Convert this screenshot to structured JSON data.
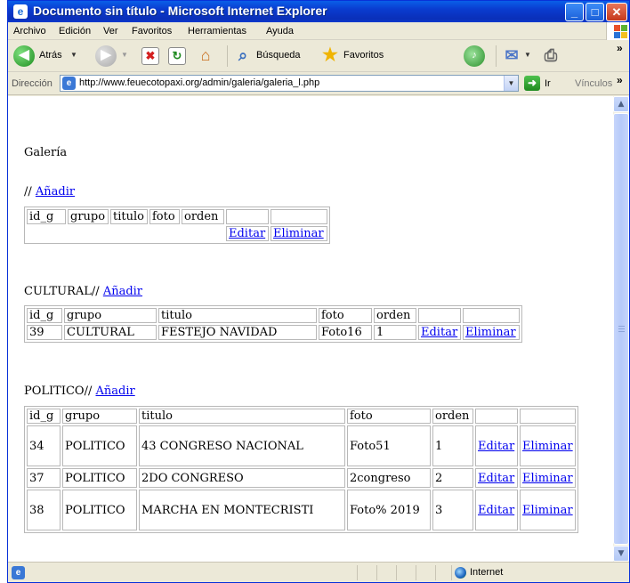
{
  "window": {
    "title": "Documento sin título - Microsoft Internet Explorer"
  },
  "menu": [
    "Archivo",
    "Edición",
    "Ver",
    "Favoritos",
    "Herramientas",
    "Ayuda"
  ],
  "toolbar": {
    "back_label": "Atrás",
    "search_label": "Búsqueda",
    "favorites_label": "Favoritos"
  },
  "address": {
    "label": "Dirección",
    "url": "http://www.feuecotopaxi.org/admin/galeria/galeria_l.php",
    "go_label": "Ir",
    "links_label": "Vínculos"
  },
  "page": {
    "heading": "Galería",
    "sections": [
      {
        "prefix": "//",
        "add_label": "Añadir",
        "headers": [
          "id_g",
          "grupo",
          "titulo",
          "foto",
          "orden",
          "",
          ""
        ],
        "rows": [
          [
            "",
            "",
            "",
            "",
            "",
            "Editar",
            "Eliminar"
          ]
        ]
      },
      {
        "prefix": "CULTURAL//",
        "add_label": "Añadir",
        "headers": [
          "id_g",
          "grupo",
          "titulo",
          "foto",
          "orden",
          "",
          ""
        ],
        "rows": [
          [
            "39",
            "CULTURAL",
            "FESTEJO NAVIDAD",
            "Foto16",
            "1",
            "Editar",
            "Eliminar"
          ]
        ]
      },
      {
        "prefix": "POLITICO//",
        "add_label": "Añadir",
        "headers": [
          "id_g",
          "grupo",
          "titulo",
          "foto",
          "orden",
          "",
          ""
        ],
        "rows": [
          [
            "34",
            "POLITICO",
            "43 CONGRESO NACIONAL",
            "Foto51",
            "1",
            "Editar",
            "Eliminar"
          ],
          [
            "37",
            "POLITICO",
            "2DO CONGRESO",
            "2congreso",
            "2",
            "Editar",
            "Eliminar"
          ],
          [
            "38",
            "POLITICO",
            "MARCHA EN MONTECRISTI",
            "Foto% 2019",
            "3",
            "Editar",
            "Eliminar"
          ]
        ]
      }
    ]
  },
  "status": {
    "zone": "Internet"
  }
}
